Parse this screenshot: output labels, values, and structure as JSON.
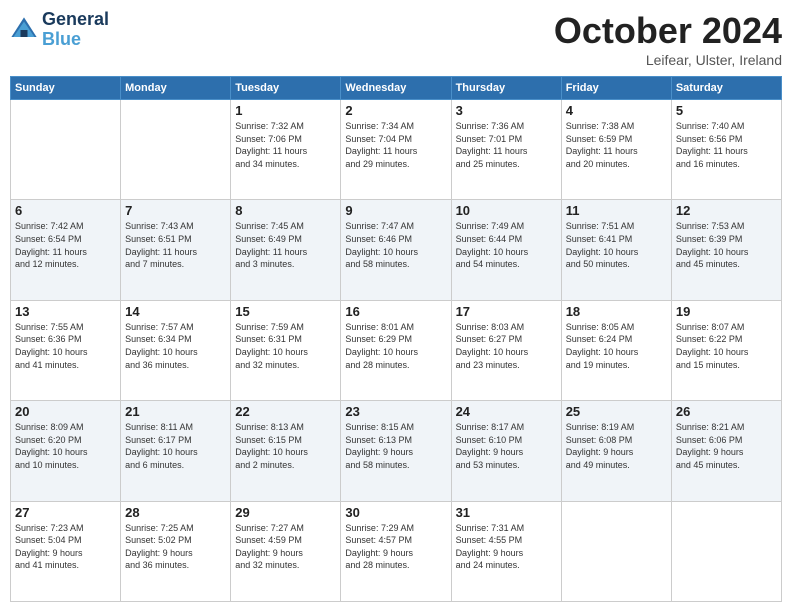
{
  "logo": {
    "line1": "General",
    "line2": "Blue"
  },
  "title": "October 2024",
  "location": "Leifear, Ulster, Ireland",
  "headers": [
    "Sunday",
    "Monday",
    "Tuesday",
    "Wednesday",
    "Thursday",
    "Friday",
    "Saturday"
  ],
  "weeks": [
    [
      {
        "day": "",
        "info": ""
      },
      {
        "day": "",
        "info": ""
      },
      {
        "day": "1",
        "info": "Sunrise: 7:32 AM\nSunset: 7:06 PM\nDaylight: 11 hours\nand 34 minutes."
      },
      {
        "day": "2",
        "info": "Sunrise: 7:34 AM\nSunset: 7:04 PM\nDaylight: 11 hours\nand 29 minutes."
      },
      {
        "day": "3",
        "info": "Sunrise: 7:36 AM\nSunset: 7:01 PM\nDaylight: 11 hours\nand 25 minutes."
      },
      {
        "day": "4",
        "info": "Sunrise: 7:38 AM\nSunset: 6:59 PM\nDaylight: 11 hours\nand 20 minutes."
      },
      {
        "day": "5",
        "info": "Sunrise: 7:40 AM\nSunset: 6:56 PM\nDaylight: 11 hours\nand 16 minutes."
      }
    ],
    [
      {
        "day": "6",
        "info": "Sunrise: 7:42 AM\nSunset: 6:54 PM\nDaylight: 11 hours\nand 12 minutes."
      },
      {
        "day": "7",
        "info": "Sunrise: 7:43 AM\nSunset: 6:51 PM\nDaylight: 11 hours\nand 7 minutes."
      },
      {
        "day": "8",
        "info": "Sunrise: 7:45 AM\nSunset: 6:49 PM\nDaylight: 11 hours\nand 3 minutes."
      },
      {
        "day": "9",
        "info": "Sunrise: 7:47 AM\nSunset: 6:46 PM\nDaylight: 10 hours\nand 58 minutes."
      },
      {
        "day": "10",
        "info": "Sunrise: 7:49 AM\nSunset: 6:44 PM\nDaylight: 10 hours\nand 54 minutes."
      },
      {
        "day": "11",
        "info": "Sunrise: 7:51 AM\nSunset: 6:41 PM\nDaylight: 10 hours\nand 50 minutes."
      },
      {
        "day": "12",
        "info": "Sunrise: 7:53 AM\nSunset: 6:39 PM\nDaylight: 10 hours\nand 45 minutes."
      }
    ],
    [
      {
        "day": "13",
        "info": "Sunrise: 7:55 AM\nSunset: 6:36 PM\nDaylight: 10 hours\nand 41 minutes."
      },
      {
        "day": "14",
        "info": "Sunrise: 7:57 AM\nSunset: 6:34 PM\nDaylight: 10 hours\nand 36 minutes."
      },
      {
        "day": "15",
        "info": "Sunrise: 7:59 AM\nSunset: 6:31 PM\nDaylight: 10 hours\nand 32 minutes."
      },
      {
        "day": "16",
        "info": "Sunrise: 8:01 AM\nSunset: 6:29 PM\nDaylight: 10 hours\nand 28 minutes."
      },
      {
        "day": "17",
        "info": "Sunrise: 8:03 AM\nSunset: 6:27 PM\nDaylight: 10 hours\nand 23 minutes."
      },
      {
        "day": "18",
        "info": "Sunrise: 8:05 AM\nSunset: 6:24 PM\nDaylight: 10 hours\nand 19 minutes."
      },
      {
        "day": "19",
        "info": "Sunrise: 8:07 AM\nSunset: 6:22 PM\nDaylight: 10 hours\nand 15 minutes."
      }
    ],
    [
      {
        "day": "20",
        "info": "Sunrise: 8:09 AM\nSunset: 6:20 PM\nDaylight: 10 hours\nand 10 minutes."
      },
      {
        "day": "21",
        "info": "Sunrise: 8:11 AM\nSunset: 6:17 PM\nDaylight: 10 hours\nand 6 minutes."
      },
      {
        "day": "22",
        "info": "Sunrise: 8:13 AM\nSunset: 6:15 PM\nDaylight: 10 hours\nand 2 minutes."
      },
      {
        "day": "23",
        "info": "Sunrise: 8:15 AM\nSunset: 6:13 PM\nDaylight: 9 hours\nand 58 minutes."
      },
      {
        "day": "24",
        "info": "Sunrise: 8:17 AM\nSunset: 6:10 PM\nDaylight: 9 hours\nand 53 minutes."
      },
      {
        "day": "25",
        "info": "Sunrise: 8:19 AM\nSunset: 6:08 PM\nDaylight: 9 hours\nand 49 minutes."
      },
      {
        "day": "26",
        "info": "Sunrise: 8:21 AM\nSunset: 6:06 PM\nDaylight: 9 hours\nand 45 minutes."
      }
    ],
    [
      {
        "day": "27",
        "info": "Sunrise: 7:23 AM\nSunset: 5:04 PM\nDaylight: 9 hours\nand 41 minutes."
      },
      {
        "day": "28",
        "info": "Sunrise: 7:25 AM\nSunset: 5:02 PM\nDaylight: 9 hours\nand 36 minutes."
      },
      {
        "day": "29",
        "info": "Sunrise: 7:27 AM\nSunset: 4:59 PM\nDaylight: 9 hours\nand 32 minutes."
      },
      {
        "day": "30",
        "info": "Sunrise: 7:29 AM\nSunset: 4:57 PM\nDaylight: 9 hours\nand 28 minutes."
      },
      {
        "day": "31",
        "info": "Sunrise: 7:31 AM\nSunset: 4:55 PM\nDaylight: 9 hours\nand 24 minutes."
      },
      {
        "day": "",
        "info": ""
      },
      {
        "day": "",
        "info": ""
      }
    ]
  ]
}
